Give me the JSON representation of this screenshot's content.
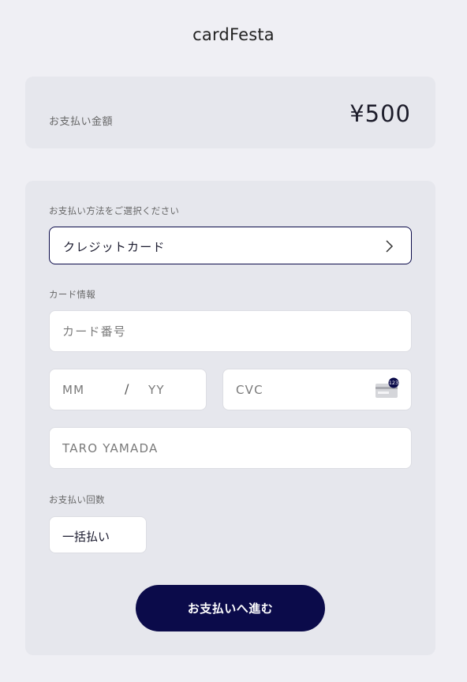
{
  "header": {
    "brand": "cardFesta"
  },
  "amount": {
    "label": "お支払い金額",
    "value": "¥500"
  },
  "payment_method": {
    "label": "お支払い方法をご選択ください",
    "selected": "クレジットカード",
    "chevron_icon": "chevron-right-icon"
  },
  "card_info": {
    "label": "カード情報",
    "card_number_placeholder": "カード番号",
    "month_placeholder": "MM",
    "slash": "/",
    "year_placeholder": "YY",
    "cvc_placeholder": "CVC",
    "cvc_icon": "card-cvc-icon",
    "cvc_badge": "123",
    "name_placeholder": "TARO YAMADA"
  },
  "installments": {
    "label": "お支払い回数",
    "selected": "一括払い"
  },
  "submit": {
    "label": "お支払いへ進む"
  },
  "colors": {
    "accent": "#0b0b4a",
    "background": "#efeff4",
    "card_bg": "#e6e7ed"
  }
}
